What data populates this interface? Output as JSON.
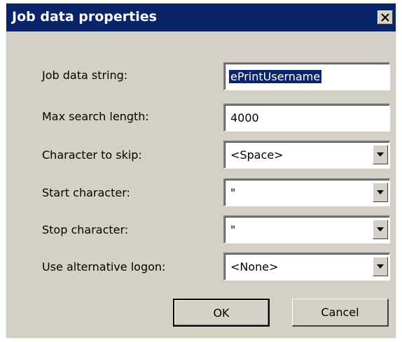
{
  "window": {
    "title": "Job data properties",
    "close_icon": "close-icon"
  },
  "fields": {
    "job_data_string": {
      "label": "Job data string:",
      "value": "ePrintUsername"
    },
    "max_search_length": {
      "label": "Max search length:",
      "value": "4000"
    },
    "character_to_skip": {
      "label": "Character to skip:",
      "value": "<Space>"
    },
    "start_character": {
      "label": "Start character:",
      "value": "\""
    },
    "stop_character": {
      "label": "Stop character:",
      "value": "\""
    },
    "alternative_logon": {
      "label": "Use alternative logon:",
      "value": "<None>"
    }
  },
  "buttons": {
    "ok": "OK",
    "cancel": "Cancel"
  },
  "colors": {
    "titlebar": "#0a246a",
    "dialog_bg": "#d4d0c8",
    "selection": "#0a246a"
  }
}
